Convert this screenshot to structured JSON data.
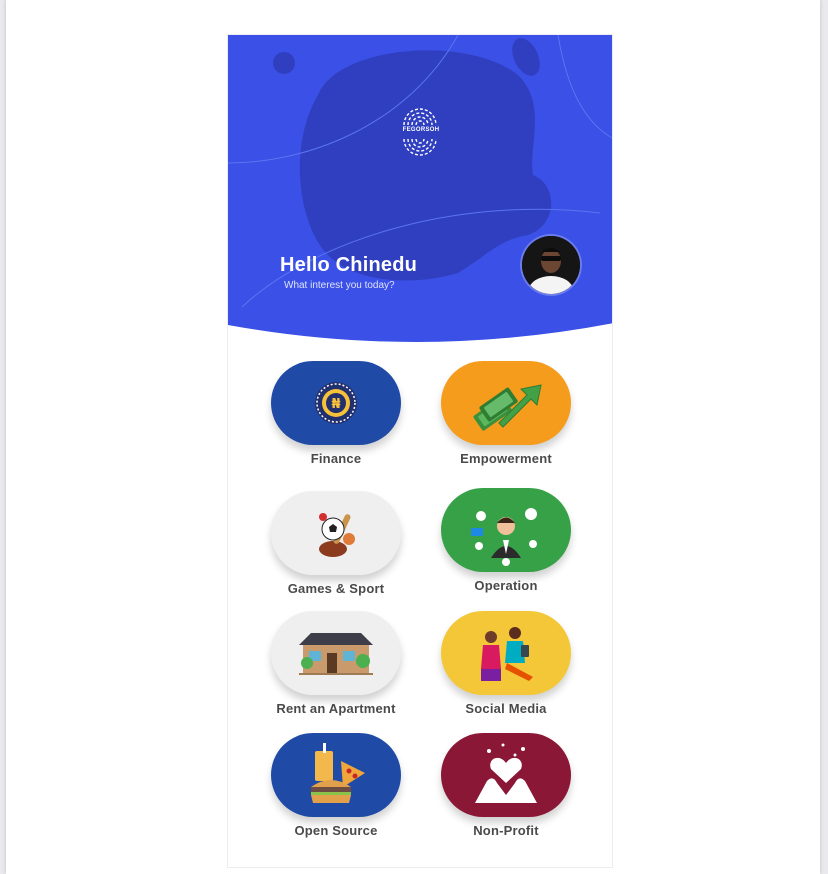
{
  "header": {
    "brand": "FEGORSOH",
    "greeting": "Hello Chinedu",
    "subtitle": "What interest you today?",
    "colors": {
      "primary": "#3a50e6",
      "blob": "#2f3fbf"
    }
  },
  "avatar": {
    "icon": "user-avatar"
  },
  "categories": [
    {
      "label": "Finance",
      "color": "#1f4aa6",
      "icon": "naira-coin-icon"
    },
    {
      "label": "Empowerment",
      "color": "#f59c1c",
      "icon": "money-growth-icon"
    },
    {
      "label": "Games & Sport",
      "color": "#efefef",
      "icon": "sports-equipment-icon"
    },
    {
      "label": "Operation",
      "color": "#36a146",
      "icon": "businessman-network-icon"
    },
    {
      "label": "Rent an Apartment",
      "color": "#efefef",
      "icon": "house-icon"
    },
    {
      "label": "Social Media",
      "color": "#f3c737",
      "icon": "people-with-phones-icon"
    },
    {
      "label": "Open Source",
      "color": "#1f4aa6",
      "icon": "fast-food-icon"
    },
    {
      "label": "Non-Profit",
      "color": "#8a1735",
      "icon": "heart-hands-icon"
    }
  ]
}
